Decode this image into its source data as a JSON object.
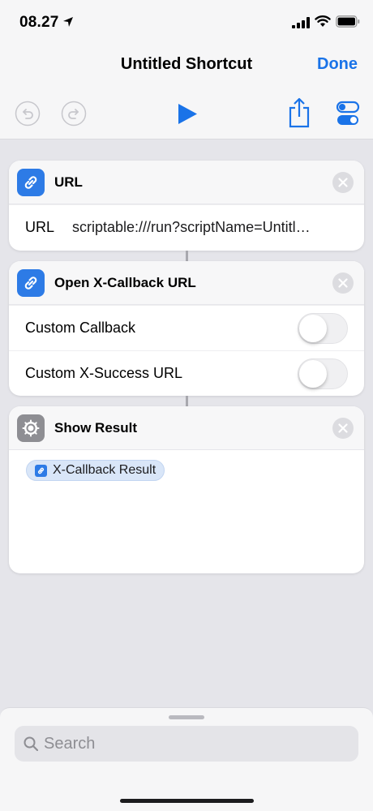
{
  "status_bar": {
    "time": "08.27"
  },
  "nav": {
    "title": "Untitled Shortcut",
    "done_label": "Done"
  },
  "colors": {
    "accent": "#1a73e8",
    "action_icon_blue": "#2d7be6",
    "action_icon_gray": "#8e8e93"
  },
  "actions": [
    {
      "title": "URL",
      "icon": "link-icon",
      "fields": [
        {
          "label": "URL",
          "value": "scriptable:///run?scriptName=Untitl…"
        }
      ]
    },
    {
      "title": "Open X-Callback URL",
      "icon": "link-icon",
      "options": [
        {
          "label": "Custom Callback",
          "on": false
        },
        {
          "label": "Custom X-Success URL",
          "on": false
        }
      ]
    },
    {
      "title": "Show Result",
      "icon": "gear-icon",
      "token": {
        "label": "X-Callback Result",
        "icon": "link-icon"
      }
    }
  ],
  "search": {
    "placeholder": "Search"
  }
}
